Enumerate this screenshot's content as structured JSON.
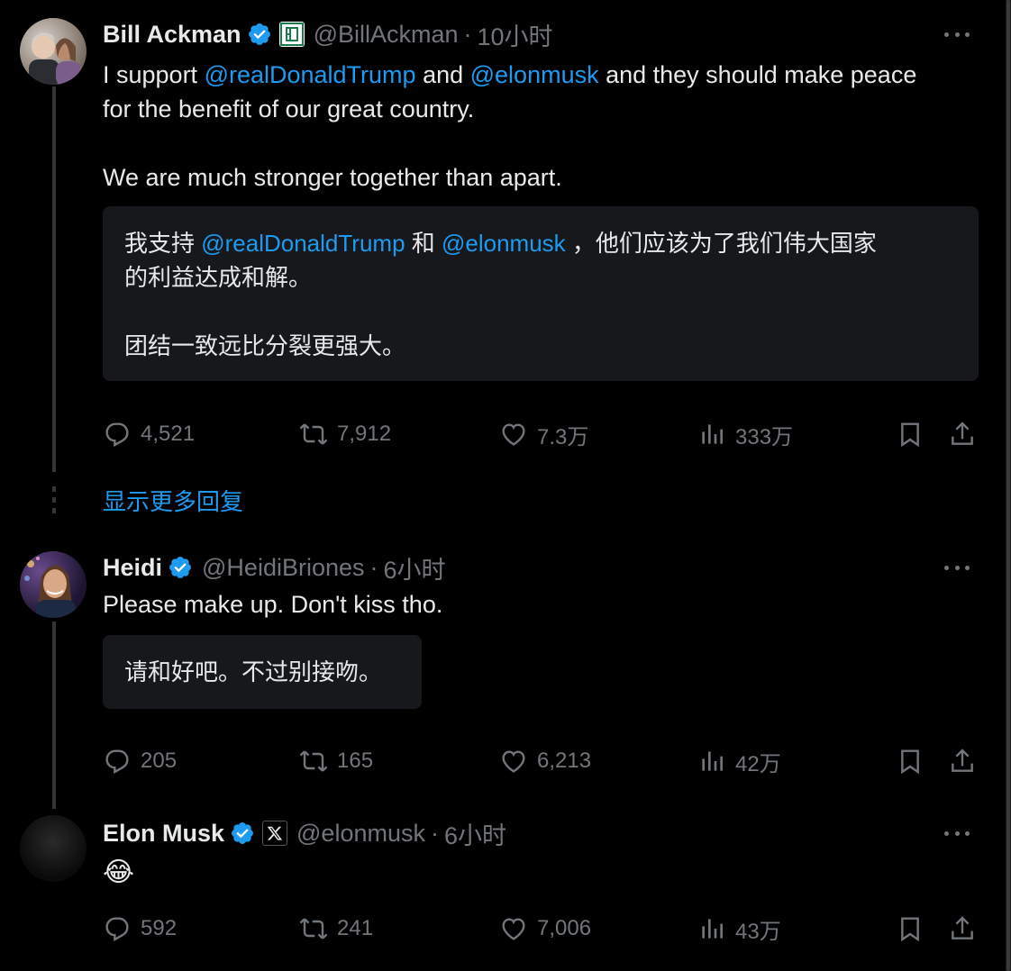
{
  "tweets": [
    {
      "name": "Bill Ackman",
      "handle": "@BillAckman",
      "dot": "·",
      "time": "10小时",
      "text_parts": [
        "I support ",
        "@realDonaldTrump",
        " and ",
        "@elonmusk",
        " and they should make peace",
        "for the benefit of our great country.",
        "We are much stronger together than apart."
      ],
      "translation_parts": [
        "我支持 ",
        "@realDonaldTrump",
        " 和 ",
        "@elonmusk",
        " ，他们应该为了我们伟大国家",
        "的利益达成和解。",
        "团结一致远比分裂更强大。"
      ],
      "replies": "4,521",
      "reposts": "7,912",
      "likes": "7.3万",
      "views": "333万"
    },
    {
      "name": "Heidi",
      "handle": "@HeidiBriones",
      "dot": "·",
      "time": "6小时",
      "text": "Please make up. Don't kiss tho.",
      "translation": "请和好吧。不过别接吻。",
      "replies": "205",
      "reposts": "165",
      "likes": "6,213",
      "views": "42万"
    },
    {
      "name": "Elon Musk",
      "handle": "@elonmusk",
      "dot": "·",
      "time": "6小时",
      "text": "😂",
      "replies": "592",
      "reposts": "241",
      "likes": "7,006",
      "views": "43万"
    }
  ],
  "show_more_replies": "显示更多回复",
  "colors": {
    "background": "#000000",
    "text": "#e7e9ea",
    "muted": "#71767b",
    "accent": "#1d9bf0",
    "translation_bg": "#16181c"
  }
}
